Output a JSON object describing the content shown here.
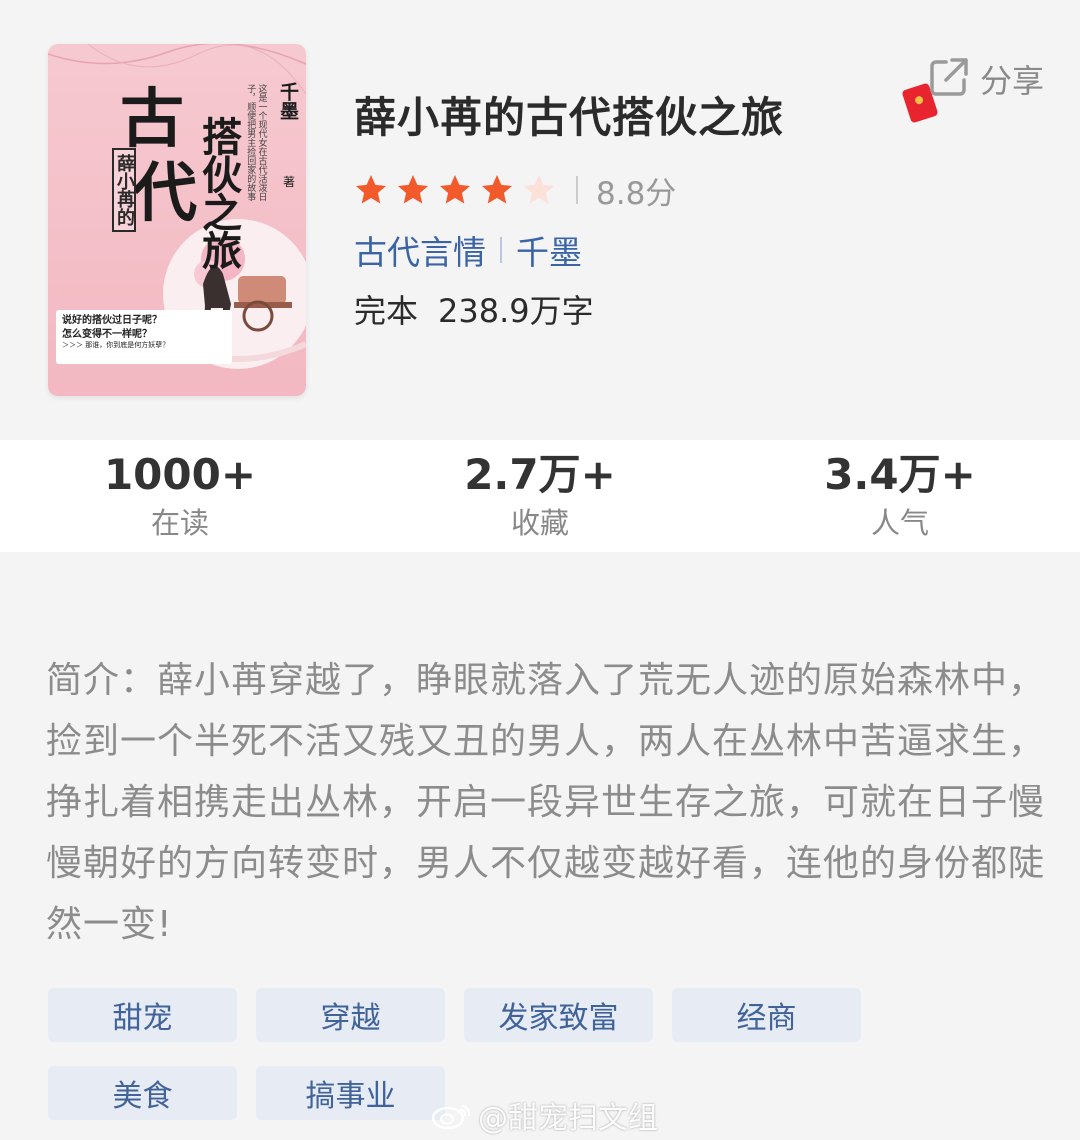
{
  "book": {
    "title": "薛小苒的古代搭伙之旅",
    "rating": {
      "stars": 4,
      "max_stars": 5,
      "score": "8.8分"
    },
    "category": "古代言情",
    "author": "千墨",
    "status": "完本",
    "word_count": "238.9万字"
  },
  "cover": {
    "main_char1": "古",
    "main_char2": "代",
    "side_title": "搭伙之旅",
    "sub_title": "薛小苒的",
    "author": "千墨",
    "author_suffix": "著",
    "blurb": "这是一个现代女在古代活泼日子，顺便把男主捡回家的故事",
    "tagline1": "说好的搭伙过日子呢？",
    "tagline2": "怎么变得不一样呢？",
    "tagline3": "＞＞＞ 那谁，你到底是何方妖孽？"
  },
  "share": {
    "label": "分享"
  },
  "stats": [
    {
      "value": "1000+",
      "label": "在读"
    },
    {
      "value": "2.7万+",
      "label": "收藏"
    },
    {
      "value": "3.4万+",
      "label": "人气"
    }
  ],
  "intro": "简介：薛小苒穿越了，睁眼就落入了荒无人迹的原始森林中，捡到一个半死不活又残又丑的男人，两人在丛林中苦逼求生，挣扎着相携走出丛林，开启一段异世生存之旅，可就在日子慢慢朝好的方向转变时，男人不仅越变越好看，连他的身份都陡然一变!",
  "tags": [
    "甜宠",
    "穿越",
    "发家致富",
    "经商",
    "美食",
    "搞事业"
  ],
  "watermark": "@甜宠扫文组",
  "colors": {
    "star": "#f25a2c",
    "star_empty": "#fbe1d8",
    "link": "#3a64a6",
    "tag_bg": "#e6ebf4",
    "tag_text": "#40639a"
  }
}
